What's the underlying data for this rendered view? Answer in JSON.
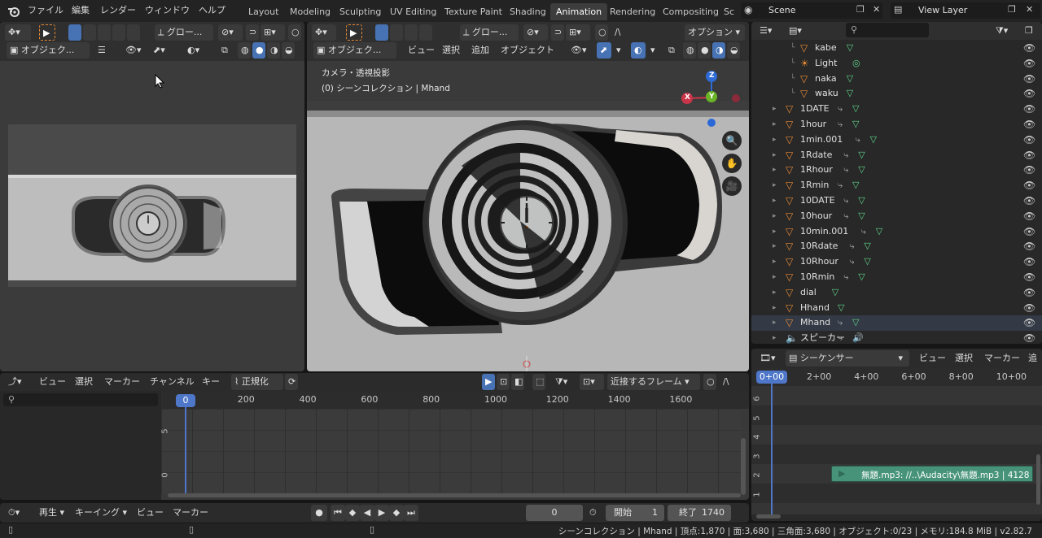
{
  "topbar": {
    "menus": [
      "ファイル",
      "編集",
      "レンダー",
      "ウィンドウ",
      "ヘルプ"
    ],
    "workspaces": [
      "Layout",
      "Modeling",
      "Sculpting",
      "UV Editing",
      "Texture Paint",
      "Shading",
      "Animation",
      "Rendering",
      "Compositing",
      "Sc"
    ],
    "active_workspace": "Animation",
    "scene": "Scene",
    "view_layer": "View Layer"
  },
  "camera_view": {
    "header": {
      "orient": "グロー...",
      "mode": "オブジェク..."
    }
  },
  "viewport": {
    "header": {
      "orient": "グロー...",
      "options": "オプション",
      "mode": "オブジェク...",
      "view": "ビュー",
      "select": "選択",
      "add": "追加",
      "object": "オブジェクト"
    },
    "overlay_title": "カメラ・透視投影",
    "overlay_sub": "(0) シーンコレクション | Mhand",
    "gizmo": {
      "x": "X",
      "y": "Y",
      "z": "Z"
    }
  },
  "outliner": {
    "items": [
      {
        "name": "kabe",
        "indent": 2
      },
      {
        "name": "Light",
        "indent": 2
      },
      {
        "name": "naka",
        "indent": 2
      },
      {
        "name": "waku",
        "indent": 2
      },
      {
        "name": "1DATE",
        "indent": 1
      },
      {
        "name": "1hour",
        "indent": 1
      },
      {
        "name": "1min.001",
        "indent": 1
      },
      {
        "name": "1Rdate",
        "indent": 1
      },
      {
        "name": "1Rhour",
        "indent": 1
      },
      {
        "name": "1Rmin",
        "indent": 1
      },
      {
        "name": "10DATE",
        "indent": 1
      },
      {
        "name": "10hour",
        "indent": 1
      },
      {
        "name": "10min.001",
        "indent": 1
      },
      {
        "name": "10Rdate",
        "indent": 1
      },
      {
        "name": "10Rhour",
        "indent": 1
      },
      {
        "name": "10Rmin",
        "indent": 1
      },
      {
        "name": "dial",
        "indent": 1
      },
      {
        "name": "Hhand",
        "indent": 1
      },
      {
        "name": "Mhand",
        "indent": 1
      },
      {
        "name": "スピーカー",
        "indent": 1
      }
    ]
  },
  "graph": {
    "header": {
      "view": "ビュー",
      "select": "選択",
      "marker": "マーカー",
      "channel": "チャンネル",
      "key": "キー",
      "normalize": "正規化",
      "pivot": "近接するフレーム"
    },
    "frames": [
      "0",
      "200",
      "400",
      "600",
      "800",
      "1000",
      "1200",
      "1400",
      "1600"
    ],
    "yticks": [
      "5",
      "0"
    ]
  },
  "sequencer": {
    "header": {
      "name": "シーケンサー",
      "view": "ビュー",
      "select": "選択",
      "marker": "マーカー",
      "add": "追加"
    },
    "times": [
      "0+00",
      "2+00",
      "4+00",
      "6+00",
      "8+00",
      "10+00"
    ],
    "channels": [
      "6",
      "5",
      "4",
      "3",
      "2",
      "1"
    ],
    "strip": "無題.mp3: //..\\Audacity\\無題.mp3 | 4128"
  },
  "timeline": {
    "playback": "再生",
    "keying": "キーイング",
    "view": "ビュー",
    "marker": "マーカー",
    "current_frame": "0",
    "start_label": "開始",
    "start": "1",
    "end_label": "終了",
    "end": "1740"
  },
  "statusbar": {
    "text": "シーンコレクション | Mhand | 頂点:1,870 | 面:3,680 | 三角面:3,680 | オブジェクト:0/23 | メモリ:184.8 MiB | v2.82.7"
  },
  "colors": {
    "accent": "#4772b3",
    "object_orange": "#e78a36",
    "data_green": "#5fd58a"
  }
}
